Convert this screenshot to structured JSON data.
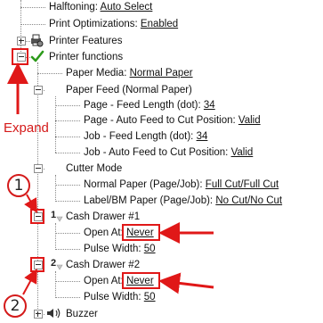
{
  "tree": {
    "halftoning": {
      "label": "Halftoning:",
      "value": "Auto Select"
    },
    "print_optimizations": {
      "label": "Print Optimizations:",
      "value": "Enabled"
    },
    "printer_features": {
      "label": "Printer Features"
    },
    "printer_functions": {
      "label": "Printer functions"
    },
    "paper_media": {
      "label": "Paper Media:",
      "value": "Normal Paper"
    },
    "paper_feed": {
      "label": "Paper Feed (Normal Paper)"
    },
    "page_feed_length": {
      "label": "Page - Feed Length (dot):",
      "value": "34"
    },
    "page_auto_feed": {
      "label": "Page - Auto Feed to Cut Position:",
      "value": "Valid"
    },
    "job_feed_length": {
      "label": "Job - Feed Length (dot):",
      "value": "34"
    },
    "job_auto_feed": {
      "label": "Job - Auto Feed to Cut Position:",
      "value": "Valid"
    },
    "cutter_mode": {
      "label": "Cutter Mode"
    },
    "normal_paper": {
      "label": "Normal Paper (Page/Job):",
      "value": "Full Cut/Full Cut"
    },
    "label_bm_paper": {
      "label": "Label/BM Paper (Page/Job):",
      "value": "No Cut/No Cut"
    },
    "cash_drawer_1": {
      "label": "Cash Drawer #1",
      "badge": "1"
    },
    "open_at_1": {
      "label": "Open At:",
      "value": "Never"
    },
    "pulse_width_1": {
      "label": "Pulse Width:",
      "value": "50"
    },
    "cash_drawer_2": {
      "label": "Cash Drawer #2",
      "badge": "2"
    },
    "open_at_2": {
      "label": "Open At:",
      "value": "Never"
    },
    "pulse_width_2": {
      "label": "Pulse Width:",
      "value": "50"
    },
    "buzzer": {
      "label": "Buzzer"
    }
  },
  "annotations": {
    "expand_label": "Expand",
    "marker_1": "1",
    "marker_2": "2",
    "accent_color": "#e01818"
  },
  "icons": {
    "printer_features": "printer-gear-icon",
    "printer_functions": "green-checkmark-icon",
    "cash_drawer_1": "drawer-1-icon",
    "cash_drawer_2": "drawer-2-icon",
    "buzzer": "speaker-icon"
  }
}
